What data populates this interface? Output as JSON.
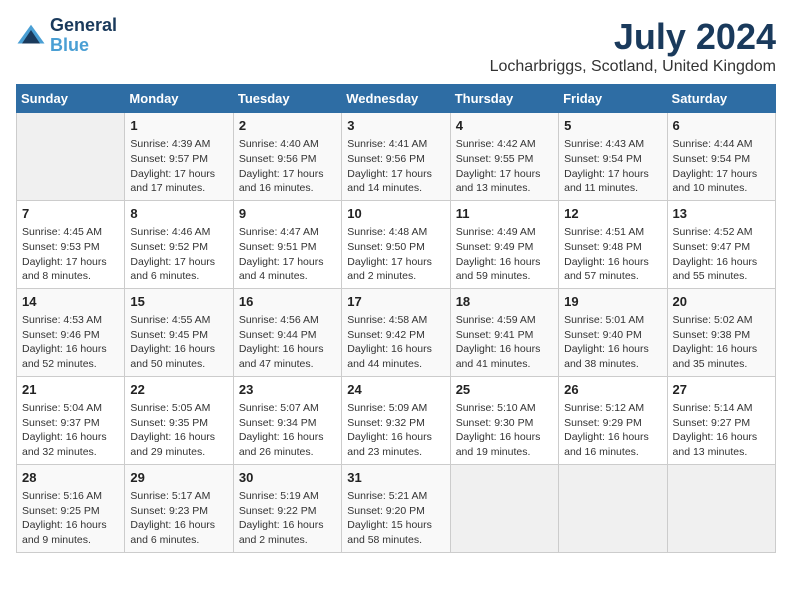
{
  "logo": {
    "line1": "General",
    "line2": "Blue"
  },
  "title": "July 2024",
  "location": "Locharbriggs, Scotland, United Kingdom",
  "days_of_week": [
    "Sunday",
    "Monday",
    "Tuesday",
    "Wednesday",
    "Thursday",
    "Friday",
    "Saturday"
  ],
  "weeks": [
    [
      {
        "day": "",
        "info": ""
      },
      {
        "day": "1",
        "info": "Sunrise: 4:39 AM\nSunset: 9:57 PM\nDaylight: 17 hours\nand 17 minutes."
      },
      {
        "day": "2",
        "info": "Sunrise: 4:40 AM\nSunset: 9:56 PM\nDaylight: 17 hours\nand 16 minutes."
      },
      {
        "day": "3",
        "info": "Sunrise: 4:41 AM\nSunset: 9:56 PM\nDaylight: 17 hours\nand 14 minutes."
      },
      {
        "day": "4",
        "info": "Sunrise: 4:42 AM\nSunset: 9:55 PM\nDaylight: 17 hours\nand 13 minutes."
      },
      {
        "day": "5",
        "info": "Sunrise: 4:43 AM\nSunset: 9:54 PM\nDaylight: 17 hours\nand 11 minutes."
      },
      {
        "day": "6",
        "info": "Sunrise: 4:44 AM\nSunset: 9:54 PM\nDaylight: 17 hours\nand 10 minutes."
      }
    ],
    [
      {
        "day": "7",
        "info": "Sunrise: 4:45 AM\nSunset: 9:53 PM\nDaylight: 17 hours\nand 8 minutes."
      },
      {
        "day": "8",
        "info": "Sunrise: 4:46 AM\nSunset: 9:52 PM\nDaylight: 17 hours\nand 6 minutes."
      },
      {
        "day": "9",
        "info": "Sunrise: 4:47 AM\nSunset: 9:51 PM\nDaylight: 17 hours\nand 4 minutes."
      },
      {
        "day": "10",
        "info": "Sunrise: 4:48 AM\nSunset: 9:50 PM\nDaylight: 17 hours\nand 2 minutes."
      },
      {
        "day": "11",
        "info": "Sunrise: 4:49 AM\nSunset: 9:49 PM\nDaylight: 16 hours\nand 59 minutes."
      },
      {
        "day": "12",
        "info": "Sunrise: 4:51 AM\nSunset: 9:48 PM\nDaylight: 16 hours\nand 57 minutes."
      },
      {
        "day": "13",
        "info": "Sunrise: 4:52 AM\nSunset: 9:47 PM\nDaylight: 16 hours\nand 55 minutes."
      }
    ],
    [
      {
        "day": "14",
        "info": "Sunrise: 4:53 AM\nSunset: 9:46 PM\nDaylight: 16 hours\nand 52 minutes."
      },
      {
        "day": "15",
        "info": "Sunrise: 4:55 AM\nSunset: 9:45 PM\nDaylight: 16 hours\nand 50 minutes."
      },
      {
        "day": "16",
        "info": "Sunrise: 4:56 AM\nSunset: 9:44 PM\nDaylight: 16 hours\nand 47 minutes."
      },
      {
        "day": "17",
        "info": "Sunrise: 4:58 AM\nSunset: 9:42 PM\nDaylight: 16 hours\nand 44 minutes."
      },
      {
        "day": "18",
        "info": "Sunrise: 4:59 AM\nSunset: 9:41 PM\nDaylight: 16 hours\nand 41 minutes."
      },
      {
        "day": "19",
        "info": "Sunrise: 5:01 AM\nSunset: 9:40 PM\nDaylight: 16 hours\nand 38 minutes."
      },
      {
        "day": "20",
        "info": "Sunrise: 5:02 AM\nSunset: 9:38 PM\nDaylight: 16 hours\nand 35 minutes."
      }
    ],
    [
      {
        "day": "21",
        "info": "Sunrise: 5:04 AM\nSunset: 9:37 PM\nDaylight: 16 hours\nand 32 minutes."
      },
      {
        "day": "22",
        "info": "Sunrise: 5:05 AM\nSunset: 9:35 PM\nDaylight: 16 hours\nand 29 minutes."
      },
      {
        "day": "23",
        "info": "Sunrise: 5:07 AM\nSunset: 9:34 PM\nDaylight: 16 hours\nand 26 minutes."
      },
      {
        "day": "24",
        "info": "Sunrise: 5:09 AM\nSunset: 9:32 PM\nDaylight: 16 hours\nand 23 minutes."
      },
      {
        "day": "25",
        "info": "Sunrise: 5:10 AM\nSunset: 9:30 PM\nDaylight: 16 hours\nand 19 minutes."
      },
      {
        "day": "26",
        "info": "Sunrise: 5:12 AM\nSunset: 9:29 PM\nDaylight: 16 hours\nand 16 minutes."
      },
      {
        "day": "27",
        "info": "Sunrise: 5:14 AM\nSunset: 9:27 PM\nDaylight: 16 hours\nand 13 minutes."
      }
    ],
    [
      {
        "day": "28",
        "info": "Sunrise: 5:16 AM\nSunset: 9:25 PM\nDaylight: 16 hours\nand 9 minutes."
      },
      {
        "day": "29",
        "info": "Sunrise: 5:17 AM\nSunset: 9:23 PM\nDaylight: 16 hours\nand 6 minutes."
      },
      {
        "day": "30",
        "info": "Sunrise: 5:19 AM\nSunset: 9:22 PM\nDaylight: 16 hours\nand 2 minutes."
      },
      {
        "day": "31",
        "info": "Sunrise: 5:21 AM\nSunset: 9:20 PM\nDaylight: 15 hours\nand 58 minutes."
      },
      {
        "day": "",
        "info": ""
      },
      {
        "day": "",
        "info": ""
      },
      {
        "day": "",
        "info": ""
      }
    ]
  ]
}
